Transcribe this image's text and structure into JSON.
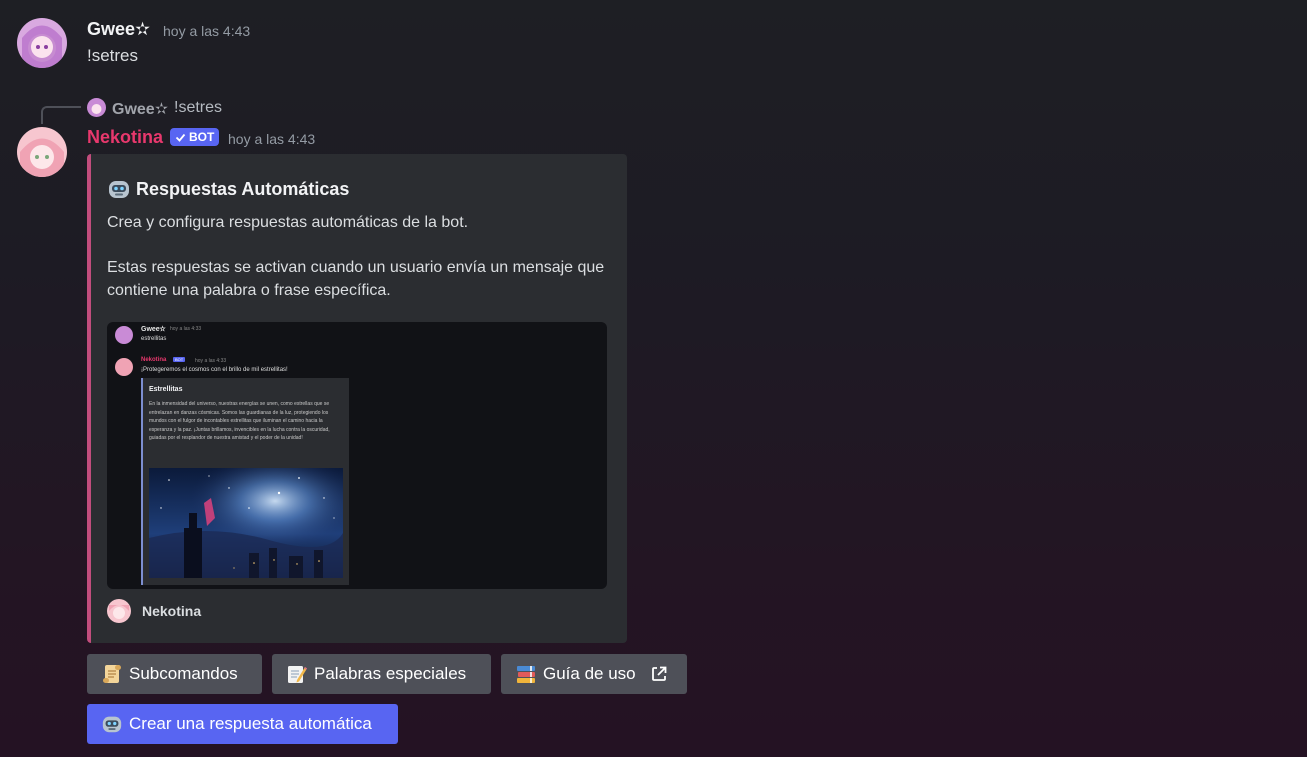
{
  "messages": {
    "first": {
      "author": "Gwee✫",
      "time": "hoy a las 4:43",
      "text": "!setres"
    },
    "reply": {
      "ref_author": "Gwee✫",
      "ref_text": "!setres",
      "author": "Nekotina",
      "bot_label": "BOT",
      "time": "hoy a las 4:43"
    }
  },
  "embed": {
    "title": "Respuestas Automáticas",
    "desc1": "Crea y configura respuestas automáticas de la bot.",
    "desc2": "Estas respuestas se activan cuando un usuario envía un mensaje que contiene una palabra o frase específica.",
    "footer": "Nekotina",
    "accent": "#c24d7d",
    "preview": {
      "user1": "Gwee✫",
      "time1": "hoy a las 4:33",
      "text1": "estrellitas",
      "bot": "Nekotina",
      "bot_label": "BOT",
      "time2": "hoy a las 4:33",
      "text2": "¡Protegeremos el cosmos con el brillo de mil estrellitas!",
      "inner_title": "Estrellitas",
      "inner_desc": "En la inmensidad del universo, nuestras energías se unen, como estrellas que se entrelazan en danzas cósmicas. Somos las guardianas de la luz, protegiendo los mundos con el fulgor de incontables estrellitas que iluminan el camino hacia la esperanza y la paz. ¡Juntas brillamos, invencibles en la lucha contra la oscuridad, guiadas por el resplandor de nuestra amistad y el poder de la unidad!"
    }
  },
  "buttons": {
    "subcommands": "Subcomandos",
    "special_words": "Palabras especiales",
    "usage_guide": "Guía de uso",
    "create": "Crear una respuesta automática"
  },
  "colors": {
    "bot_name": "#e8386d",
    "blurple": "#5865f2",
    "secondary_button": "#4e5058"
  },
  "icons": [
    "robot-icon",
    "scroll-icon",
    "memo-icon",
    "books-icon",
    "external-link-icon",
    "check-icon"
  ]
}
